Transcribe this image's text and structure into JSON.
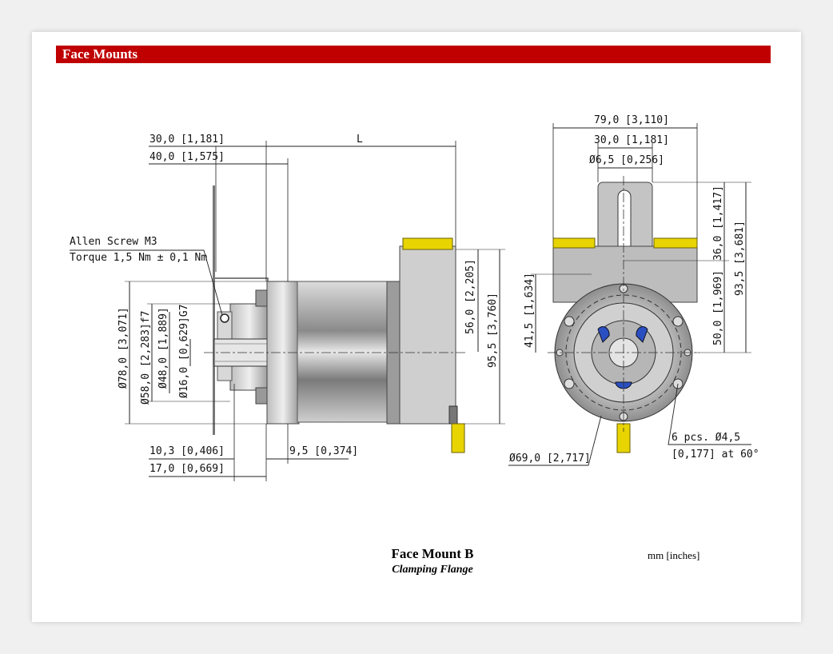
{
  "section": {
    "title": "Face Mounts"
  },
  "caption": {
    "title": "Face Mount B",
    "subtitle": "Clamping Flange"
  },
  "units": "mm [inches]",
  "side_view": {
    "dim_30": "30,0 [1,181]",
    "dim_40": "40,0 [1,575]",
    "dim_L": "L",
    "screw_label_1": "Allen Screw M3",
    "screw_label_2": "Torque 1,5 Nm ± 0,1 Nm",
    "dim_78": "Ø78,0 [3,071]",
    "dim_58": "Ø58,0 [2,283]f7",
    "dim_48": "Ø48,0 [1,889]",
    "dim_16": "Ø16,0 [0,629]G7",
    "dim_56": "56,0 [2,205]",
    "dim_95": "95,5 [3,760]",
    "dim_10": "10,3 [0,406]",
    "dim_17": "17,0 [0,669]",
    "dim_9": "9,5 [0,374]"
  },
  "front_view": {
    "dim_79": "79,0 [3,110]",
    "dim_30": "30,0 [1,181]",
    "dim_6": "Ø6,5 [0,256]",
    "dim_36": "36,0 [1,417]",
    "dim_93": "93,5 [3,681]",
    "dim_50": "50,0 [1,969]",
    "dim_41": "41,5 [1,634]",
    "dim_69": "Ø69,0 [2,717]",
    "holes_1": "6 pcs. Ø4,5",
    "holes_2": "[0,177] at 60°"
  },
  "colors": {
    "bar": "#c00000",
    "connector": "#e8d400",
    "body": "#c8c8c8"
  }
}
